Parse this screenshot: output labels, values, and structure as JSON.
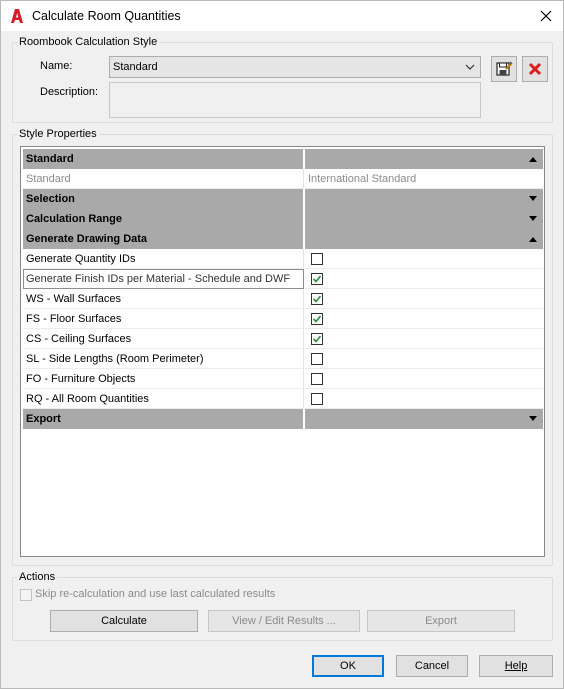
{
  "window": {
    "title": "Calculate Room Quantities"
  },
  "style_group": {
    "title": "Roombook Calculation Style",
    "name_label": "Name:",
    "name_value": "Standard",
    "description_label": "Description:",
    "description_value": ""
  },
  "properties": {
    "title": "Style Properties",
    "rows": [
      {
        "kind": "category",
        "label": "Standard",
        "value": "",
        "expanded": true
      },
      {
        "kind": "item",
        "label": "Standard",
        "value": "International Standard",
        "disabled": true
      },
      {
        "kind": "category",
        "label": "Selection",
        "value": "",
        "expanded": false
      },
      {
        "kind": "category",
        "label": "Calculation Range",
        "value": "",
        "expanded": false
      },
      {
        "kind": "category",
        "label": "Generate Drawing Data",
        "value": "",
        "expanded": true
      },
      {
        "kind": "check",
        "label": "Generate Quantity IDs",
        "checked": false
      },
      {
        "kind": "check",
        "label": "Generate Finish IDs per Material - Schedule and DWF",
        "checked": true,
        "selected": true
      },
      {
        "kind": "check",
        "label": "WS - Wall Surfaces",
        "checked": true
      },
      {
        "kind": "check",
        "label": "FS - Floor Surfaces",
        "checked": true
      },
      {
        "kind": "check",
        "label": "CS - Ceiling Surfaces",
        "checked": true
      },
      {
        "kind": "check",
        "label": "SL - Side Lengths (Room Perimeter)",
        "checked": false
      },
      {
        "kind": "check",
        "label": "FO - Furniture Objects",
        "checked": false
      },
      {
        "kind": "check",
        "label": "RQ - All Room Quantities",
        "checked": false
      },
      {
        "kind": "category",
        "label": "Export",
        "value": "",
        "expanded": false
      }
    ]
  },
  "actions": {
    "title": "Actions",
    "skip_label": "Skip re-calculation and use last calculated results",
    "skip_checked": false,
    "calculate_label": "Calculate",
    "view_edit_label": "View / Edit Results ...",
    "export_label": "Export"
  },
  "footer": {
    "ok_label": "OK",
    "cancel_label": "Cancel",
    "help_label": "Help"
  },
  "icons": {
    "app": "autocad-a-icon",
    "close": "close-icon",
    "save_style": "save-edit-icon",
    "delete_style": "delete-x-icon",
    "dropdown": "chevron-down-icon",
    "collapse": "triangle-up-icon",
    "expand": "triangle-down-icon"
  },
  "colors": {
    "category_bg": "#a9a9a9",
    "check_green": "#2e8b3d",
    "delete_red": "#e01b1b",
    "app_red": "#d0202a",
    "default_button_border": "#0078d7"
  }
}
